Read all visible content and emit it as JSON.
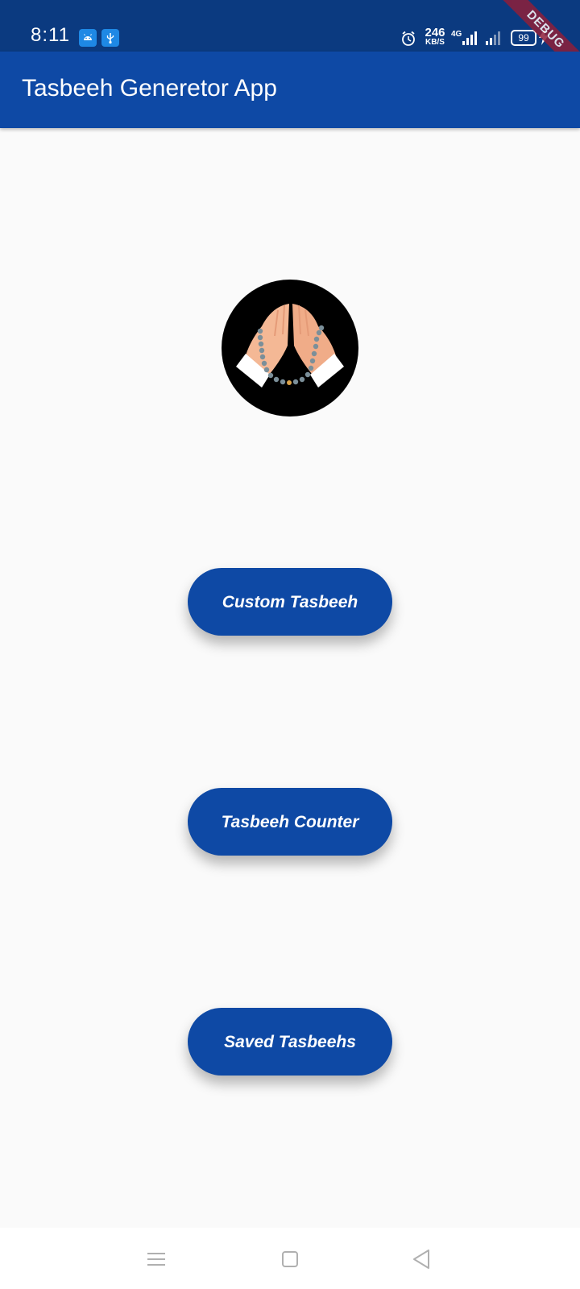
{
  "status_bar": {
    "time": "8:11",
    "network_speed_value": "246",
    "network_speed_unit": "KB/S",
    "network_type": "4G",
    "battery_level": "99",
    "icons": [
      "android-icon",
      "usb-icon",
      "alarm-icon",
      "signal-icon",
      "signal-icon",
      "charging-icon"
    ]
  },
  "debug_banner": "DEBUG",
  "app_bar": {
    "title": "Tasbeeh Generetor App"
  },
  "logo": {
    "icon": "praying-hands-with-prayer-beads-icon"
  },
  "buttons": {
    "custom_tasbeeh": "Custom Tasbeeh",
    "tasbeeh_counter": "Tasbeeh Counter",
    "saved_tasbeehs": "Saved Tasbeehs"
  },
  "nav_bar": {
    "icons": [
      "menu-icon",
      "home-icon",
      "back-icon"
    ]
  },
  "colors": {
    "status_bar": "#0b3a80",
    "primary": "#0e49a5",
    "background": "#fafafa",
    "debug_ribbon": "#8e1f3a"
  }
}
